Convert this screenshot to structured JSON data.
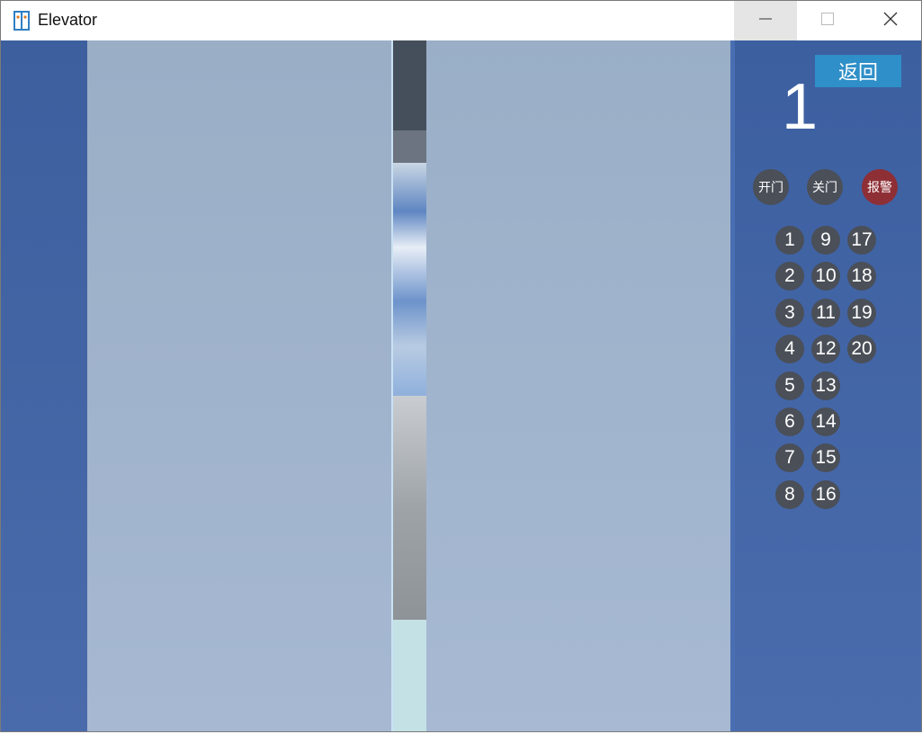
{
  "window": {
    "title": "Elevator",
    "icon": "elevator-app-icon"
  },
  "controls": {
    "minimize_icon": "minimize-icon",
    "maximize_icon": "maximize-icon",
    "close_icon": "close-icon"
  },
  "panel": {
    "back_label": "返回",
    "current_floor": "1",
    "open_label": "开门",
    "close_label": "关门",
    "alarm_label": "报警",
    "floors_col1": [
      "1",
      "2",
      "3",
      "4",
      "5",
      "6",
      "7",
      "8"
    ],
    "floors_col2": [
      "9",
      "10",
      "11",
      "12",
      "13",
      "14",
      "15",
      "16"
    ],
    "floors_col3": [
      "17",
      "18",
      "19",
      "20"
    ]
  },
  "colors": {
    "panel_bg": "#3c5fa0",
    "button_bg": "#4a4f58",
    "alarm_bg": "#8e2e35",
    "back_button_bg": "#2f8fc8"
  }
}
